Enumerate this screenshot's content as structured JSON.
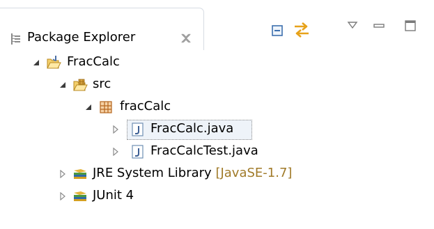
{
  "view": {
    "title": "Package Explorer",
    "icons": {
      "view": "package-explorer-icon",
      "close": "close-icon",
      "collapse_all": "collapse-all-icon",
      "link_with_editor": "link-with-editor-icon",
      "view_menu": "view-menu-icon",
      "minimize": "minimize-icon",
      "maximize": "maximize-icon"
    }
  },
  "tree": {
    "project": {
      "label": "FracCalc",
      "expanded": true,
      "icon": "java-project-icon"
    },
    "src_folder": {
      "label": "src",
      "expanded": true,
      "icon": "source-folder-icon"
    },
    "package": {
      "label": "fracCalc",
      "expanded": true,
      "icon": "package-icon"
    },
    "files": [
      {
        "label": "FracCalc.java",
        "selected": true,
        "icon": "java-file-icon"
      },
      {
        "label": "FracCalcTest.java",
        "selected": false,
        "icon": "java-file-icon"
      }
    ],
    "libraries": [
      {
        "label": "JRE System Library",
        "decoration": "[JavaSE-1.7]",
        "icon": "library-icon"
      },
      {
        "label": "JUnit 4",
        "decoration": "",
        "icon": "library-icon"
      }
    ]
  },
  "colors": {
    "decoration": "#a07a28",
    "selection_border": "#8a8a8a",
    "tab_border": "#d7dce3"
  }
}
